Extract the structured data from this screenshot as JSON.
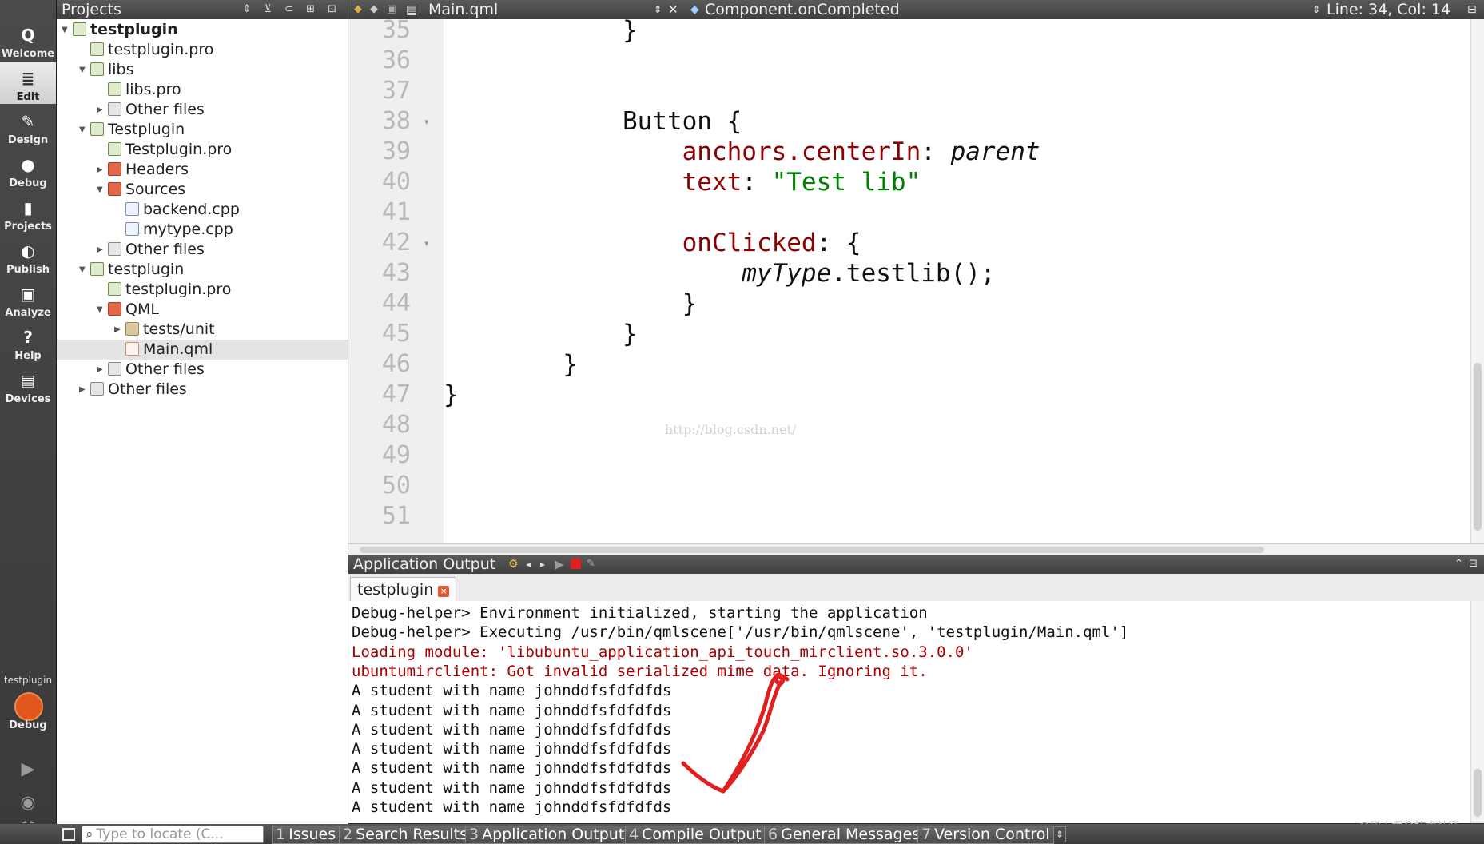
{
  "modes": [
    {
      "name": "mode-welcome",
      "label": "Welcome",
      "icon": "qt-logo-icon",
      "glyph": "Q"
    },
    {
      "name": "mode-edit",
      "label": "Edit",
      "icon": "document-icon",
      "glyph": "≣",
      "active": true
    },
    {
      "name": "mode-design",
      "label": "Design",
      "icon": "pencil-icon",
      "glyph": "✎"
    },
    {
      "name": "mode-debug",
      "label": "Debug",
      "icon": "bug-icon",
      "glyph": "●"
    },
    {
      "name": "mode-projects",
      "label": "Projects",
      "icon": "wrench-icon",
      "glyph": "▮"
    },
    {
      "name": "mode-publish",
      "label": "Publish",
      "icon": "globe-icon",
      "glyph": "◐"
    },
    {
      "name": "mode-analyze",
      "label": "Analyze",
      "icon": "monitor-icon",
      "glyph": "▣"
    },
    {
      "name": "mode-help",
      "label": "Help",
      "icon": "help-icon",
      "glyph": "?"
    },
    {
      "name": "mode-devices",
      "label": "Devices",
      "icon": "device-icon",
      "glyph": "▤"
    }
  ],
  "kit": {
    "project": "testplugin",
    "build": "Debug"
  },
  "projects": {
    "title": "Projects",
    "tree": [
      {
        "label": "testplugin",
        "depth": 0,
        "arrow": "open",
        "icon": "proj",
        "bold": true
      },
      {
        "label": "testplugin.pro",
        "depth": 1,
        "arrow": "none",
        "icon": "proj"
      },
      {
        "label": "libs",
        "depth": 1,
        "arrow": "open",
        "icon": "proj"
      },
      {
        "label": "libs.pro",
        "depth": 2,
        "arrow": "none",
        "icon": "proj"
      },
      {
        "label": "Other files",
        "depth": 2,
        "arrow": "closed",
        "icon": "other"
      },
      {
        "label": "Testplugin",
        "depth": 1,
        "arrow": "open",
        "icon": "proj"
      },
      {
        "label": "Testplugin.pro",
        "depth": 2,
        "arrow": "none",
        "icon": "proj"
      },
      {
        "label": "Headers",
        "depth": 2,
        "arrow": "closed",
        "icon": "red"
      },
      {
        "label": "Sources",
        "depth": 2,
        "arrow": "open",
        "icon": "red"
      },
      {
        "label": "backend.cpp",
        "depth": 3,
        "arrow": "none",
        "icon": "cpp"
      },
      {
        "label": "mytype.cpp",
        "depth": 3,
        "arrow": "none",
        "icon": "cpp"
      },
      {
        "label": "Other files",
        "depth": 2,
        "arrow": "closed",
        "icon": "other"
      },
      {
        "label": "testplugin",
        "depth": 1,
        "arrow": "open",
        "icon": "proj"
      },
      {
        "label": "testplugin.pro",
        "depth": 2,
        "arrow": "none",
        "icon": "proj"
      },
      {
        "label": "QML",
        "depth": 2,
        "arrow": "open",
        "icon": "red"
      },
      {
        "label": "tests/unit",
        "depth": 3,
        "arrow": "closed",
        "icon": "folder"
      },
      {
        "label": "Main.qml",
        "depth": 3,
        "arrow": "none",
        "icon": "qml",
        "selected": true
      },
      {
        "label": "Other files",
        "depth": 2,
        "arrow": "closed",
        "icon": "other"
      },
      {
        "label": "Other files",
        "depth": 1,
        "arrow": "closed",
        "icon": "other"
      }
    ]
  },
  "editor": {
    "file": "Main.qml",
    "symbol": "Component.onCompleted",
    "position": "Line: 34, Col: 14",
    "lines": [
      {
        "num": "35",
        "segs": [
          {
            "t": "            }",
            "c": ""
          }
        ]
      },
      {
        "num": "36",
        "segs": []
      },
      {
        "num": "37",
        "segs": []
      },
      {
        "num": "38",
        "fold": true,
        "segs": [
          {
            "t": "            Button {",
            "c": ""
          }
        ]
      },
      {
        "num": "39",
        "segs": [
          {
            "t": "                ",
            "c": ""
          },
          {
            "t": "anchors.centerIn",
            "c": "prop"
          },
          {
            "t": ": ",
            "c": ""
          },
          {
            "t": "parent",
            "c": "ital"
          }
        ]
      },
      {
        "num": "40",
        "segs": [
          {
            "t": "                ",
            "c": ""
          },
          {
            "t": "text",
            "c": "prop"
          },
          {
            "t": ": ",
            "c": ""
          },
          {
            "t": "\"Test lib\"",
            "c": "str"
          }
        ]
      },
      {
        "num": "41",
        "segs": []
      },
      {
        "num": "42",
        "fold": true,
        "segs": [
          {
            "t": "                ",
            "c": ""
          },
          {
            "t": "onClicked",
            "c": "prop"
          },
          {
            "t": ": {",
            "c": ""
          }
        ]
      },
      {
        "num": "43",
        "segs": [
          {
            "t": "                    ",
            "c": ""
          },
          {
            "t": "myType",
            "c": "ital"
          },
          {
            "t": ".testlib();",
            "c": ""
          }
        ]
      },
      {
        "num": "44",
        "segs": [
          {
            "t": "                }",
            "c": ""
          }
        ]
      },
      {
        "num": "45",
        "segs": [
          {
            "t": "            }",
            "c": ""
          }
        ]
      },
      {
        "num": "46",
        "segs": [
          {
            "t": "        }",
            "c": ""
          }
        ]
      },
      {
        "num": "47",
        "segs": [
          {
            "t": "}",
            "c": ""
          }
        ]
      },
      {
        "num": "48",
        "segs": []
      },
      {
        "num": "49",
        "segs": []
      },
      {
        "num": "50",
        "segs": []
      },
      {
        "num": "51",
        "segs": []
      }
    ],
    "watermark": "http://blog.csdn.net/"
  },
  "output": {
    "title": "Application Output",
    "tab": "testplugin",
    "lines": [
      {
        "text": "Debug-helper> Environment initialized, starting the application",
        "err": false
      },
      {
        "text": "Debug-helper> Executing /usr/bin/qmlscene['/usr/bin/qmlscene', 'testplugin/Main.qml']",
        "err": false
      },
      {
        "text": "Loading module: 'libubuntu_application_api_touch_mirclient.so.3.0.0'",
        "err": true
      },
      {
        "text": "ubuntumirclient: Got invalid serialized mime data. Ignoring it.",
        "err": true
      },
      {
        "text": "A student with name johnddfsfdfdfds",
        "err": false
      },
      {
        "text": "A student with name johnddfsfdfdfds",
        "err": false
      },
      {
        "text": "A student with name johnddfsfdfdfds",
        "err": false
      },
      {
        "text": "A student with name johnddfsfdfdfds",
        "err": false
      },
      {
        "text": "A student with name johnddfsfdfdfds",
        "err": false
      },
      {
        "text": "A student with name johnddfsfdfdfds",
        "err": false
      },
      {
        "text": "A student with name johnddfsfdfdfds",
        "err": false
      }
    ],
    "brand": "@稀土掘金技术社区"
  },
  "statusbar": {
    "locator_placeholder": "Type to locate (C...",
    "tabs": [
      {
        "num": "1",
        "label": "Issues"
      },
      {
        "num": "2",
        "label": "Search Results"
      },
      {
        "num": "3",
        "label": "Application Output"
      },
      {
        "num": "4",
        "label": "Compile Output"
      },
      {
        "num": "6",
        "label": "General Messages"
      },
      {
        "num": "7",
        "label": "Version Control"
      }
    ]
  },
  "colors": {
    "accent_red": "#e02020",
    "error_text": "#aa0000",
    "string_green": "#008000",
    "property_red": "#8b0000"
  }
}
